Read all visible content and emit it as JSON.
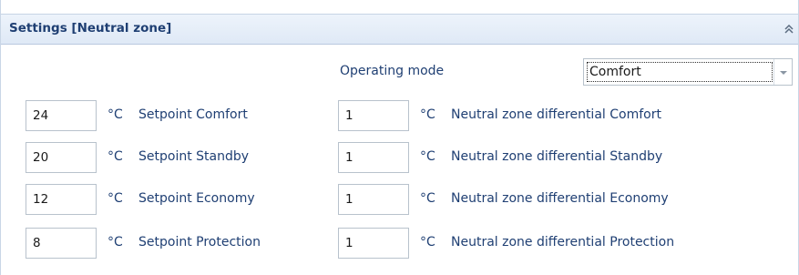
{
  "panel": {
    "title": "Settings [Neutral zone]",
    "collapse_icon": "double-chevron-up-icon"
  },
  "operating_mode": {
    "label": "Operating mode",
    "selected": "Comfort"
  },
  "setpoints": [
    {
      "value": "24",
      "unit": "°C",
      "label": "Setpoint Comfort"
    },
    {
      "value": "20",
      "unit": "°C",
      "label": "Setpoint Standby"
    },
    {
      "value": "12",
      "unit": "°C",
      "label": "Setpoint Economy"
    },
    {
      "value": "8",
      "unit": "°C",
      "label": "Setpoint Protection"
    }
  ],
  "differentials": [
    {
      "value": "1",
      "unit": "°C",
      "label": "Neutral zone differential Comfort"
    },
    {
      "value": "1",
      "unit": "°C",
      "label": "Neutral zone differential Standby"
    },
    {
      "value": "1",
      "unit": "°C",
      "label": "Neutral zone differential Economy"
    },
    {
      "value": "1",
      "unit": "°C",
      "label": "Neutral zone differential Protection"
    }
  ]
}
